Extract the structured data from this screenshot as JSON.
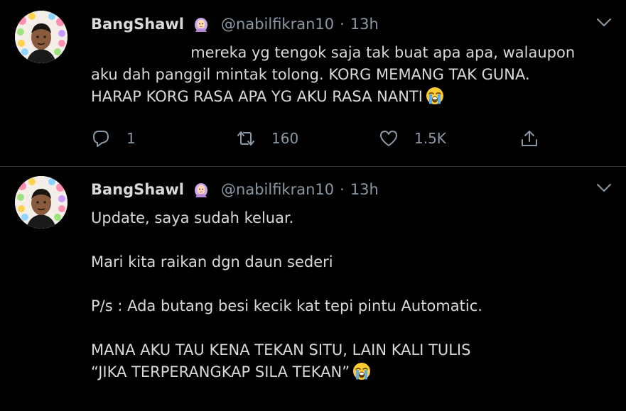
{
  "tweets": [
    {
      "display_name": "BangShawl",
      "handle": "@nabilfikran10",
      "separator": "·",
      "time": "13h",
      "text": "mereka yg tengok saja tak buat apa apa, walaupon\naku dah panggil mintak tolong. KORG MEMANG TAK GUNA.\nHARAP KORG RASA APA YG AKU RASA NANTI",
      "lead_indent": "                     ",
      "trailing_emoji": "loudly-crying-face-emoji",
      "reply_count": "1",
      "retweet_count": "160",
      "like_count": "1.5K"
    },
    {
      "display_name": "BangShawl",
      "handle": "@nabilfikran10",
      "separator": "·",
      "time": "13h",
      "text": "Update, saya sudah keluar.\n\nMari kita raikan dgn daun sederi\n\nP/s : Ada butang besi kecik kat tepi pintu Automatic.\n\nMANA AKU TAU KENA TEKAN SITU, LAIN KALI TULIS\n“JIKA TERPERANGKAP SILA TEKAN”",
      "trailing_emoji": "loudly-crying-face-emoji"
    }
  ],
  "icons": {
    "badge": "woman-with-headscarf-emoji",
    "more": "chevron-down-icon",
    "reply": "reply-icon",
    "retweet": "retweet-icon",
    "like": "heart-icon",
    "share": "share-icon"
  },
  "colors": {
    "background": "#000000",
    "text": "#d9d9d9",
    "muted": "#8b98a5",
    "divider": "#2f3336"
  }
}
